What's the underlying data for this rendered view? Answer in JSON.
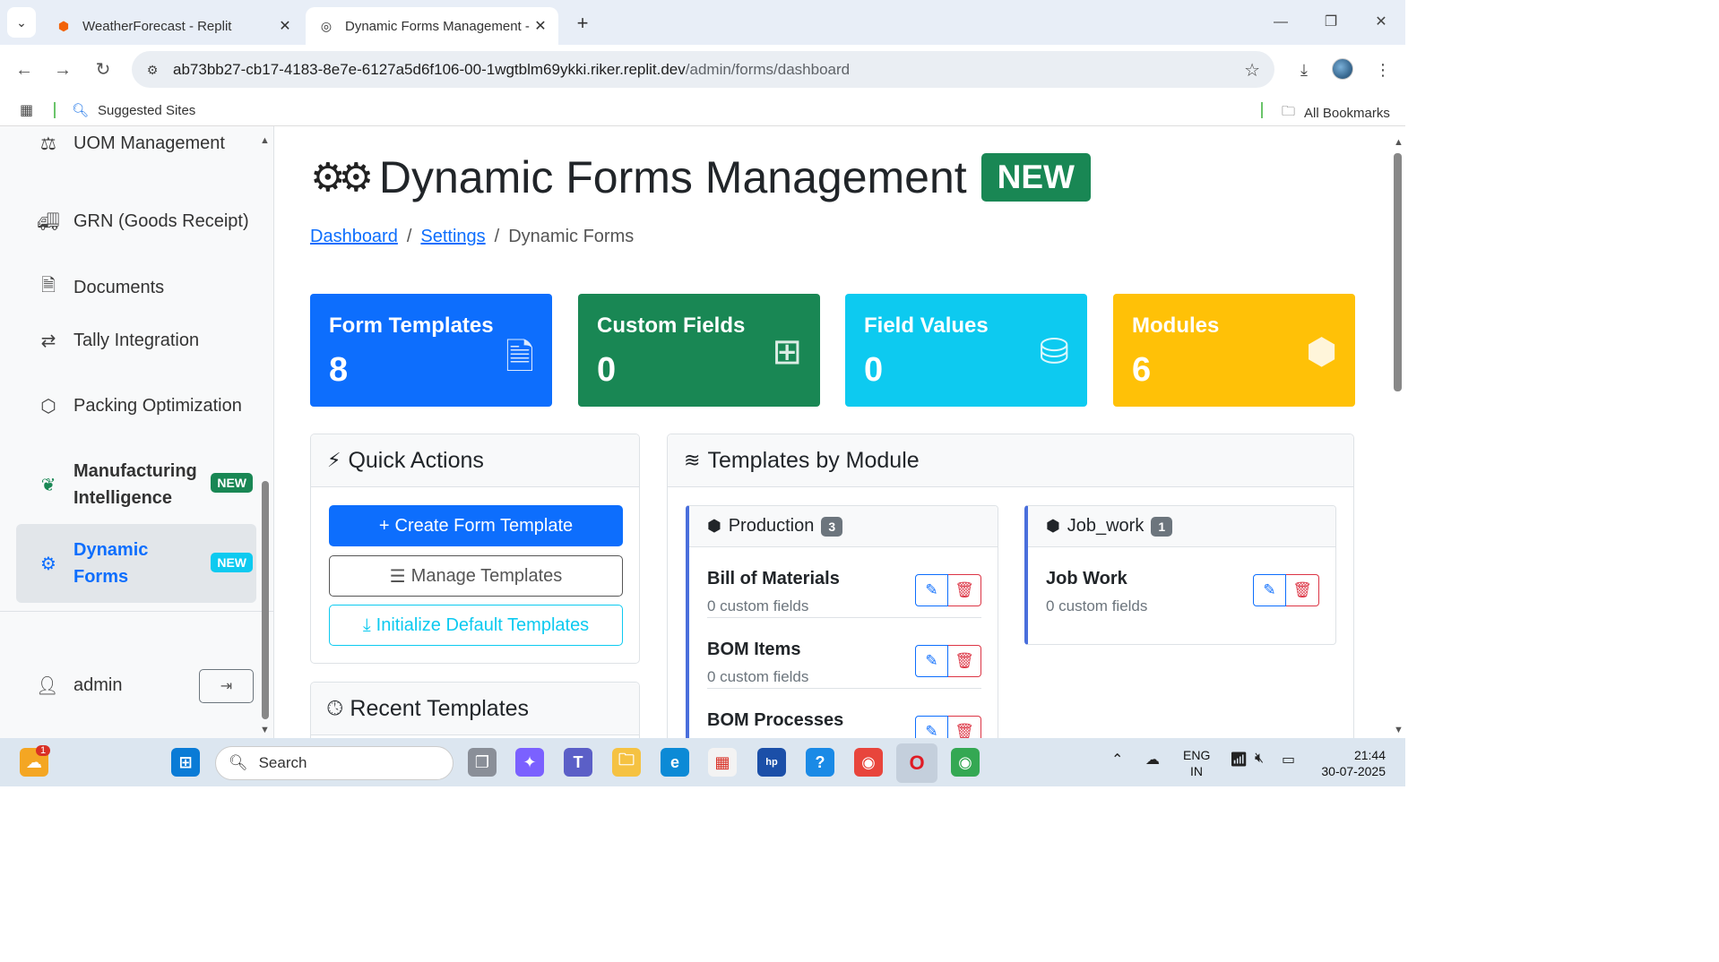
{
  "browser": {
    "tabs": [
      {
        "title": "WeatherForecast - Replit",
        "active": false
      },
      {
        "title": "Dynamic Forms Management -",
        "active": true
      }
    ],
    "url_host": "ab73bb27-cb17-4183-8e7e-6127a5d6f106-00-1wgtblm69ykki.riker.replit.dev",
    "url_path": "/admin/forms/dashboard",
    "bookmarks": {
      "suggested": "Suggested Sites",
      "all": "All Bookmarks"
    }
  },
  "sidebar": {
    "items": [
      {
        "label": "UOM Management",
        "icon": "balance-scale-icon"
      },
      {
        "label": "GRN (Goods Receipt)",
        "icon": "truck-icon"
      },
      {
        "label": "Documents",
        "icon": "file-icon"
      },
      {
        "label": "Tally Integration",
        "icon": "exchange-icon"
      },
      {
        "label": "Packing Optimization",
        "icon": "cubes-icon"
      },
      {
        "label": "Manufacturing Intelligence",
        "icon": "brain-icon",
        "badge": "NEW"
      },
      {
        "label": "Dynamic Forms",
        "icon": "cogs-icon",
        "badge": "NEW",
        "active": true
      }
    ],
    "user": "admin"
  },
  "main": {
    "title": "Dynamic Forms Management",
    "title_badge": "NEW",
    "breadcrumb": [
      "Dashboard",
      "Settings",
      "Dynamic Forms"
    ],
    "stats": [
      {
        "label": "Form Templates",
        "value": "8",
        "color": "#0d6efd",
        "icon": "file-text-icon"
      },
      {
        "label": "Custom Fields",
        "value": "0",
        "color": "#198754",
        "icon": "plus-square-icon"
      },
      {
        "label": "Field Values",
        "value": "0",
        "color": "#0dcaf0",
        "icon": "database-icon"
      },
      {
        "label": "Modules",
        "value": "6",
        "color": "#ffc107",
        "icon": "cubes-icon"
      }
    ],
    "quick_actions": {
      "title": "Quick Actions",
      "buttons": [
        "Create Form Template",
        "Manage Templates",
        "Initialize Default Templates"
      ]
    },
    "recent": {
      "title": "Recent Templates"
    },
    "templates_by_module": {
      "title": "Templates by Module",
      "modules": [
        {
          "name": "Production",
          "count": "3",
          "templates": [
            {
              "name": "Bill of Materials",
              "fields": "0 custom fields"
            },
            {
              "name": "BOM Items",
              "fields": "0 custom fields"
            },
            {
              "name": "BOM Processes",
              "fields": ""
            }
          ]
        },
        {
          "name": "Job_work",
          "count": "1",
          "templates": [
            {
              "name": "Job Work",
              "fields": "0 custom fields"
            }
          ]
        }
      ]
    }
  },
  "taskbar": {
    "search_placeholder": "Search",
    "lang": [
      "ENG",
      "IN"
    ],
    "time": "21:44",
    "date": "30-07-2025",
    "notification_count": "1"
  }
}
